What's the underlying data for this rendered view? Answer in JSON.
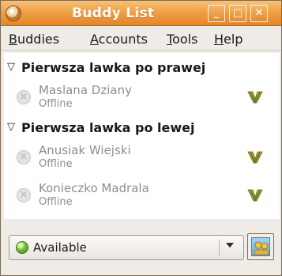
{
  "window": {
    "title": "Buddy List",
    "controls": {
      "minimize": "_",
      "maximize": "□",
      "close": "✕"
    }
  },
  "menubar": {
    "items": [
      {
        "label_u": "B",
        "label_rest": "uddies"
      },
      {
        "label_u": "A",
        "label_rest": "ccounts"
      },
      {
        "label_u": "T",
        "label_rest": "ools"
      },
      {
        "label_u": "H",
        "label_rest": "elp"
      }
    ]
  },
  "groups": [
    {
      "name": "Pierwsza lawka po prawej",
      "buddies": [
        {
          "name": "Maslana Dziany",
          "status": "Offline",
          "protocol_icon": "gadu-gadu-icon"
        }
      ]
    },
    {
      "name": "Pierwsza lawka po lewej",
      "buddies": [
        {
          "name": "Anusiak Wiejski",
          "status": "Offline",
          "protocol_icon": "gadu-gadu-icon"
        },
        {
          "name": "Konieczko Madrala",
          "status": "Offline",
          "protocol_icon": "gadu-gadu-icon"
        }
      ]
    }
  ],
  "status_selector": {
    "selected": "Available",
    "status_color": "#7cc43a"
  },
  "colors": {
    "titlebar_accent": "#f0a045",
    "offline_text": "#8e8e8e"
  }
}
